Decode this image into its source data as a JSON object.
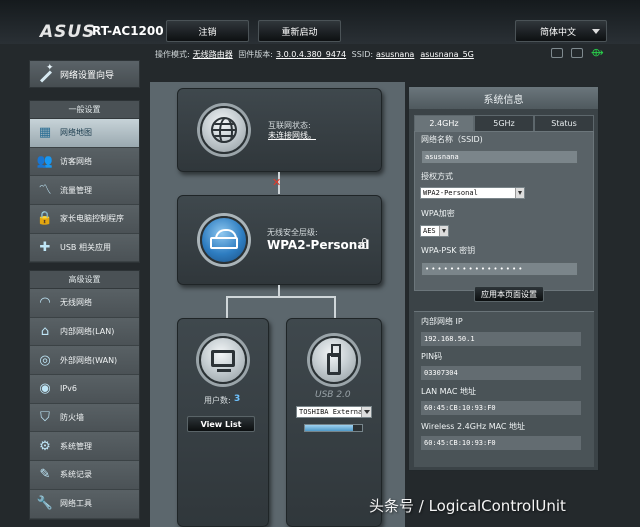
{
  "header": {
    "logo": "ASUS",
    "model": "RT-AC1200",
    "logout_label": "注销",
    "reboot_label": "重新启动",
    "language": "简体中文"
  },
  "info_bar": {
    "mode_label": "操作模式:",
    "mode_value": "无线路由器",
    "firmware_label": "固件版本:",
    "firmware_value": "3.0.0.4.380_9474",
    "ssid_label": "SSID:",
    "ssid_24": "asusnana",
    "ssid_5g": "asusnana_5G"
  },
  "sidebar": {
    "wizard_label": "网络设置向导",
    "general_title": "一般设置",
    "general_items": [
      {
        "label": "网络地图",
        "icon": "network-map-icon",
        "glyph": "▦"
      },
      {
        "label": "访客网络",
        "icon": "guest-network-icon",
        "glyph": "👥"
      },
      {
        "label": "流量管理",
        "icon": "traffic-icon",
        "glyph": "〽"
      },
      {
        "label": "家长电脑控制程序",
        "icon": "lock-icon",
        "glyph": "🔒"
      },
      {
        "label": "USB 相关应用",
        "icon": "puzzle-icon",
        "glyph": "✚"
      }
    ],
    "advanced_title": "高级设置",
    "advanced_items": [
      {
        "label": "无线网络",
        "icon": "wifi-icon",
        "glyph": "◠"
      },
      {
        "label": "内部网络(LAN)",
        "icon": "home-icon",
        "glyph": "⌂"
      },
      {
        "label": "外部网络(WAN)",
        "icon": "globe-icon",
        "glyph": "◎"
      },
      {
        "label": "IPv6",
        "icon": "ipv6-icon",
        "glyph": "◉"
      },
      {
        "label": "防火墙",
        "icon": "shield-icon",
        "glyph": "⛉"
      },
      {
        "label": "系统管理",
        "icon": "admin-icon",
        "glyph": "⚙"
      },
      {
        "label": "系统记录",
        "icon": "log-icon",
        "glyph": "✎"
      },
      {
        "label": "网络工具",
        "icon": "tools-icon",
        "glyph": "🔧"
      }
    ]
  },
  "map": {
    "internet_label": "互联网状态:",
    "internet_status": "未连接网线。",
    "security_label": "无线安全层级:",
    "security_value": "WPA2-Personal",
    "clients_label": "用户数:",
    "clients_count": "3",
    "view_list_label": "View List",
    "usb_label": "USB 2.0",
    "usb_device": "TOSHIBA External",
    "usb_progress": 0.85
  },
  "sysinfo": {
    "title": "系统信息",
    "tabs": [
      "2.4GHz",
      "5GHz",
      "Status"
    ],
    "ssid_label": "网络名称（SSID)",
    "ssid_value": "asusnana",
    "auth_label": "授权方式",
    "auth_value": "WPA2-Personal",
    "enc_label": "WPA加密",
    "enc_value": "AES",
    "psk_label": "WPA-PSK 密钥",
    "psk_value": "••••••••••••••••",
    "apply_label": "应用本页面设置",
    "lan_ip_label": "内部网络 IP",
    "lan_ip_value": "192.168.50.1",
    "pin_label": "PIN码",
    "pin_value": "03307304",
    "lan_mac_label": "LAN MAC 地址",
    "lan_mac_value": "60:45:CB:10:93:F0",
    "wl_mac_label": "Wireless 2.4GHz MAC 地址",
    "wl_mac_value": "60:45:CB:10:93:F0"
  },
  "watermark": "头条号 / LogicalControlUnit"
}
